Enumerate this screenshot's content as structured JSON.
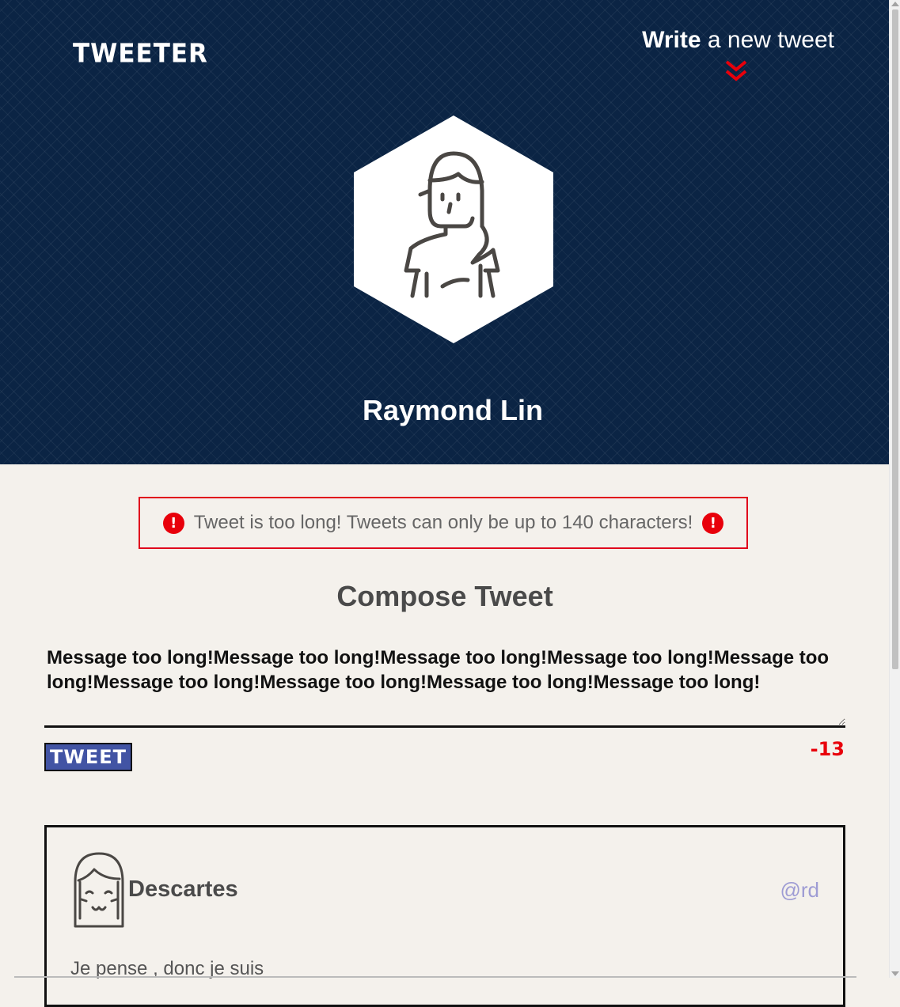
{
  "header": {
    "brand": "TWEETER",
    "nav_write_bold": "Write",
    "nav_write_rest": " a new tweet",
    "chevron_icon": "double-chevron-down-icon",
    "avatar_icon": "hexagon-avatar-girl-icon",
    "user_name": "Raymond Lin"
  },
  "error": {
    "icon": "exclamation-circle-icon",
    "message": "Tweet is too long! Tweets can only be up to 140 characters!",
    "color": "#e0001b"
  },
  "compose": {
    "title": "Compose Tweet",
    "text": "Message too long!Message too long!Message too long!Message too long!Message too long!Message too long!Message too long!Message too long!Message too long!",
    "button_label": "TWEET",
    "counter": "-13",
    "button_color": "#4254a4",
    "counter_color": "#e8000b"
  },
  "tweets": [
    {
      "avatar_icon": "girl-face-avatar-icon",
      "name": "Descartes",
      "handle": "@rd",
      "content": "Je pense , donc je suis"
    }
  ],
  "colors": {
    "header_bg": "#0b2444",
    "page_bg": "#f4f1ec",
    "handle_color": "#9e9cd4"
  }
}
